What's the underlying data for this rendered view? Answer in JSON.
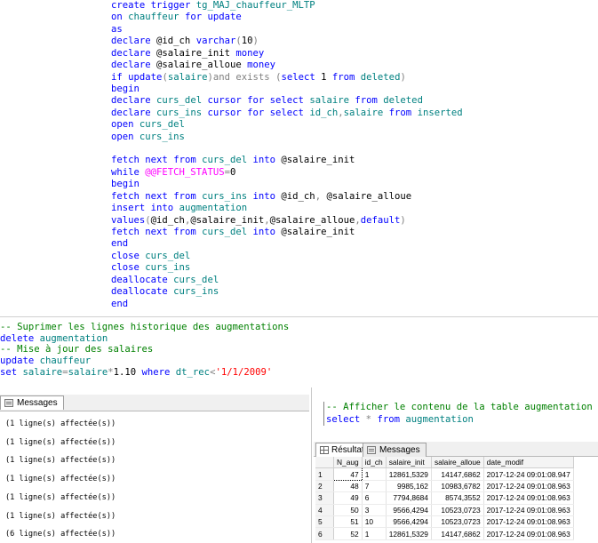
{
  "code_top": [
    "create trigger tg_MAJ_chauffeur_MLTP",
    "on chauffeur for update",
    "as",
    "declare @id_ch varchar(10)",
    "declare @salaire_init money",
    "declare @salaire_alloue money",
    "if update(salaire)and exists (select 1 from deleted)",
    "begin",
    "declare curs_del cursor for select salaire from deleted",
    "declare curs_ins cursor for select id_ch,salaire from inserted",
    "open curs_del",
    "open curs_ins",
    "",
    "fetch next from curs_del into @salaire_init",
    "while @@FETCH_STATUS=0",
    "begin",
    "fetch next from curs_ins into @id_ch, @salaire_alloue",
    "insert into augmentation",
    "values(@id_ch,@salaire_init,@salaire_alloue,default)",
    "fetch next from curs_del into @salaire_init",
    "end",
    "close curs_del",
    "close curs_ins",
    "deallocate curs_del",
    "deallocate curs_ins",
    "end"
  ],
  "code_mid": [
    "-- Suprimer les lignes historique des augmentations",
    "delete augmentation",
    "-- Mise à jour des salaires",
    "update chauffeur",
    "set salaire=salaire*1.10 where dt_rec<'1/1/2009'"
  ],
  "code_right": [
    "-- Afficher le contenu de la table augmentation",
    "select * from augmentation"
  ],
  "left_tab": {
    "label": "Messages"
  },
  "messages": [
    "(1 ligne(s) affectée(s))",
    "(1 ligne(s) affectée(s))",
    "(1 ligne(s) affectée(s))",
    "(1 ligne(s) affectée(s))",
    "(1 ligne(s) affectée(s))",
    "(1 ligne(s) affectée(s))",
    "(6 ligne(s) affectée(s))"
  ],
  "right_tabs": {
    "results_label": "Résultats",
    "messages_label": "Messages"
  },
  "results": {
    "columns": [
      "N_aug",
      "id_ch",
      "salaire_init",
      "salaire_alloue",
      "date_modif"
    ],
    "rows": [
      [
        "1",
        "47",
        "1",
        "12861,5329",
        "14147,6862",
        "2017-12-24 09:01:08.947"
      ],
      [
        "2",
        "48",
        "7",
        "9985,162",
        "10983,6782",
        "2017-12-24 09:01:08.963"
      ],
      [
        "3",
        "49",
        "6",
        "7794,8684",
        "8574,3552",
        "2017-12-24 09:01:08.963"
      ],
      [
        "4",
        "50",
        "3",
        "9566,4294",
        "10523,0723",
        "2017-12-24 09:01:08.963"
      ],
      [
        "5",
        "51",
        "10",
        "9566,4294",
        "10523,0723",
        "2017-12-24 09:01:08.963"
      ],
      [
        "6",
        "52",
        "1",
        "12861,5329",
        "14147,6862",
        "2017-12-24 09:01:08.963"
      ]
    ]
  }
}
